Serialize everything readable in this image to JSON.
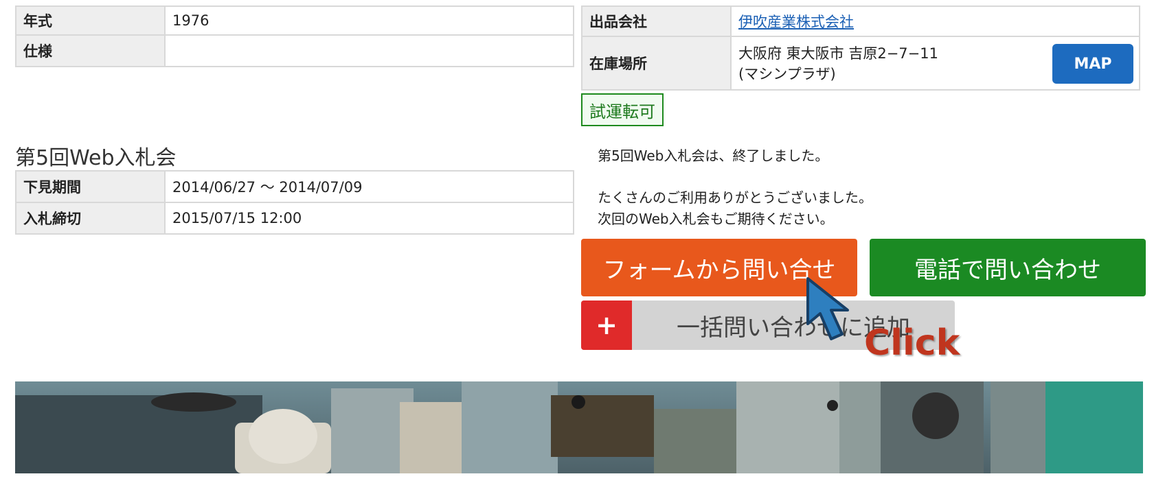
{
  "spec_table": {
    "rows": [
      {
        "label": "年式",
        "value": "1976"
      },
      {
        "label": "仕様",
        "value": ""
      }
    ]
  },
  "seller_table": {
    "company_label": "出品会社",
    "company_name": "伊吹産業株式会社",
    "location_label": "在庫場所",
    "location_line1": "大阪府 東大阪市 吉原2−7−11",
    "location_line2": "(マシンプラザ)",
    "map_button": "MAP"
  },
  "trial_badge": "試運転可",
  "auction": {
    "title": "第5回Web入札会",
    "rows": [
      {
        "label": "下見期間",
        "value": "2014/06/27 〜 2014/07/09"
      },
      {
        "label": "入札締切",
        "value": "2015/07/15 12:00"
      }
    ]
  },
  "notice": {
    "line1": "第5回Web入札会は、終了しました。",
    "line2": "たくさんのご利用ありがとうございました。",
    "line3": "次回のWeb入札会もご期待ください。"
  },
  "buttons": {
    "form_inquiry": "フォームから問い合せ",
    "phone_inquiry": "電話で問い合わせ",
    "batch_add_icon": "+",
    "batch_add": "一括問い合わせに追加"
  },
  "overlay": {
    "click_label": "Click",
    "cursor_icon": "pointer-arrow-icon"
  },
  "photo": {
    "alt": "machine photo"
  },
  "colors": {
    "form_button": "#e8581c",
    "phone_button": "#1b8a23",
    "map_button": "#1d6bbf",
    "batch_plus": "#e02a2a",
    "trial_badge": "#1e8a1e",
    "click_text": "#c0351e"
  }
}
